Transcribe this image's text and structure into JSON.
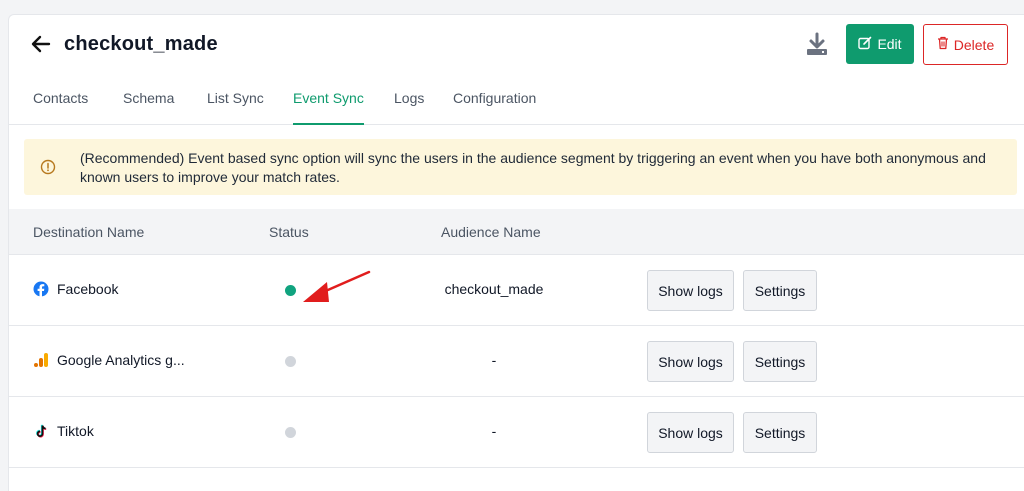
{
  "header": {
    "title": "checkout_made",
    "edit_label": "Edit",
    "delete_label": "Delete"
  },
  "tabs": [
    {
      "label": "Contacts",
      "active": false
    },
    {
      "label": "Schema",
      "active": false
    },
    {
      "label": "List Sync",
      "active": false
    },
    {
      "label": "Event Sync",
      "active": true
    },
    {
      "label": "Logs",
      "active": false
    },
    {
      "label": "Configuration",
      "active": false
    }
  ],
  "alert": {
    "text": "(Recommended) Event based sync option will sync the users in the audience segment by triggering an event when you have both anonymous and known users to improve your match rates."
  },
  "table": {
    "headers": {
      "destination": "Destination Name",
      "status": "Status",
      "audience": "Audience Name"
    },
    "rows": [
      {
        "destination": "Facebook",
        "icon": "facebook-icon",
        "status": "active",
        "status_color": "#10a37f",
        "audience": "checkout_made",
        "logs_label": "Show logs",
        "settings_label": "Settings"
      },
      {
        "destination": "Google Analytics g...",
        "icon": "google-analytics-icon",
        "status": "inactive",
        "status_color": "#d1d5db",
        "audience": "-",
        "logs_label": "Show logs",
        "settings_label": "Settings"
      },
      {
        "destination": "Tiktok",
        "icon": "tiktok-icon",
        "status": "inactive",
        "status_color": "#d1d5db",
        "audience": "-",
        "logs_label": "Show logs",
        "settings_label": "Settings"
      }
    ]
  },
  "colors": {
    "accent": "#0f9b6e",
    "danger": "#dc2626",
    "alert_bg": "#fdf6dc",
    "annotation_arrow": "#e11d1d"
  }
}
